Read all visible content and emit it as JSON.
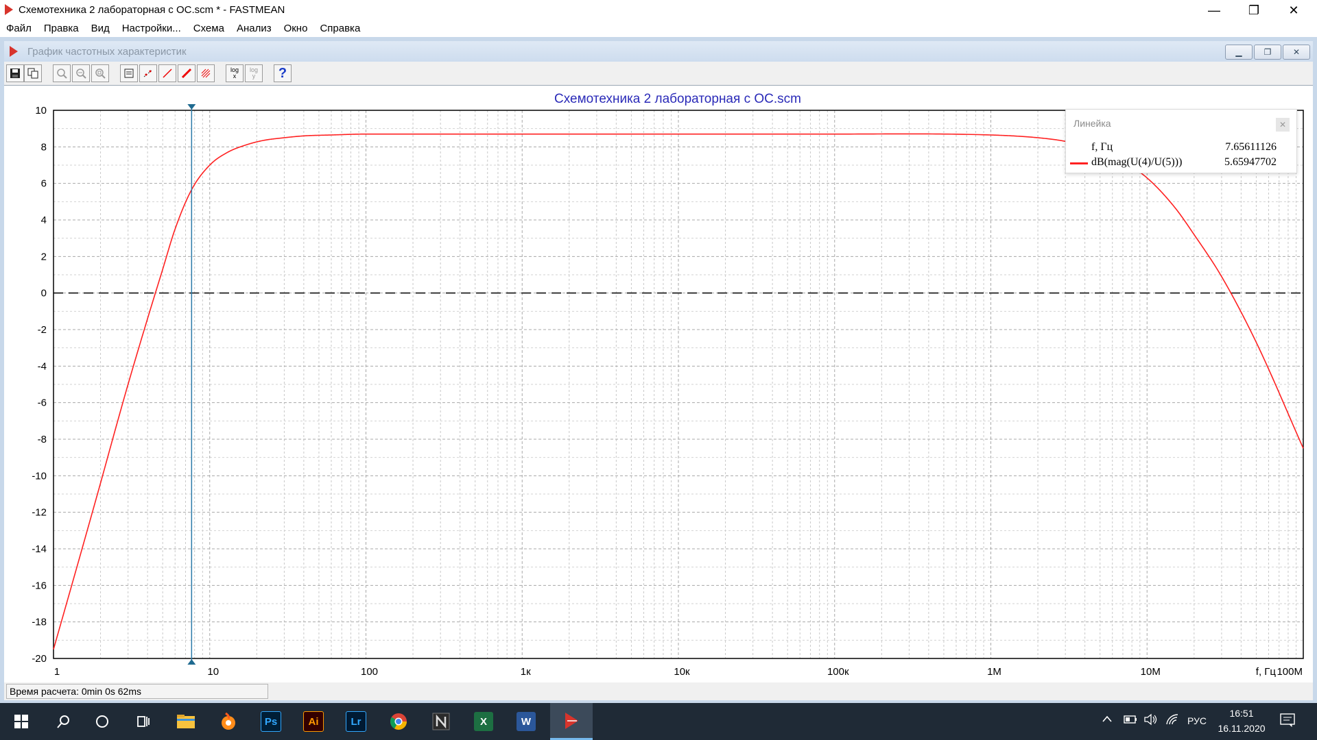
{
  "window": {
    "title": "Схемотехника 2 лабораторная с ОС.scm * - FASTMEAN",
    "minimize_label": "—",
    "restore_label": "❐",
    "close_label": "✕"
  },
  "menu": [
    "Файл",
    "Правка",
    "Вид",
    "Настройки...",
    "Схема",
    "Анализ",
    "Окно",
    "Справка"
  ],
  "child_window": {
    "title": "График частотных характеристик"
  },
  "toolbar": {
    "log_x_top": "log",
    "log_x_bottom": "x",
    "log_y_top": "log",
    "log_y_bottom": "y",
    "help_label": "?"
  },
  "chart_data": {
    "type": "line",
    "title": "Схемотехника 2 лабораторная с ОС.scm",
    "xscale": "log",
    "xlim": [
      1,
      100000000
    ],
    "ylim": [
      -20,
      10
    ],
    "yticks": [
      10,
      8,
      6,
      4,
      2,
      0,
      -2,
      -4,
      -6,
      -8,
      -10,
      -12,
      -14,
      -16,
      -18,
      -20
    ],
    "xticks": [
      {
        "value": 1,
        "label": "1"
      },
      {
        "value": 10,
        "label": "10"
      },
      {
        "value": 100,
        "label": "100"
      },
      {
        "value": 1000,
        "label": "1к"
      },
      {
        "value": 10000,
        "label": "10к"
      },
      {
        "value": 100000,
        "label": "100к"
      },
      {
        "value": 1000000,
        "label": "1М"
      },
      {
        "value": 10000000,
        "label": "10М"
      },
      {
        "value": 100000000,
        "label": "100М"
      }
    ],
    "xlabel": "f, Гц",
    "grid": true,
    "zero_line": true,
    "series": [
      {
        "name": "dB(mag(U(4)/U(5)))",
        "color": "#ff2020",
        "x": [
          1,
          1.5,
          2,
          2.5,
          3,
          4,
          5,
          6,
          7.66,
          10,
          13,
          17,
          22,
          30,
          40,
          60,
          100,
          1000,
          10000,
          100000,
          1000000,
          2000000,
          3000000,
          5000000,
          7000000,
          10000000,
          15000000,
          20000000,
          30000000,
          50000000,
          100000000
        ],
        "y": [
          -19.5,
          -14.2,
          -10.4,
          -7.4,
          -5.0,
          -1.4,
          1.3,
          3.5,
          5.66,
          7.0,
          7.7,
          8.1,
          8.35,
          8.5,
          8.6,
          8.65,
          8.7,
          8.7,
          8.7,
          8.7,
          8.65,
          8.5,
          8.3,
          7.8,
          7.2,
          6.3,
          4.7,
          3.2,
          0.9,
          -2.7,
          -8.5
        ]
      }
    ],
    "cursor": {
      "x": 7.65611126,
      "y": 5.65947702
    }
  },
  "ruler": {
    "title": "Линейка",
    "close_label": "✕",
    "f_label": "f, Гц",
    "f_value": "7.65611126",
    "series_label": "dB(mag(U(4)/U(5)))",
    "series_value": "5.65947702"
  },
  "status": {
    "text": "Время расчета: 0min 0s 62ms"
  },
  "taskbar": {
    "apps": [
      {
        "name": "photoshop",
        "label": "Ps",
        "bg": "#001e36",
        "fg": "#31a8ff"
      },
      {
        "name": "illustrator",
        "label": "Ai",
        "bg": "#330000",
        "fg": "#ff9a00"
      },
      {
        "name": "lightroom",
        "label": "Lr",
        "bg": "#001a33",
        "fg": "#31a8ff"
      },
      {
        "name": "excel",
        "label": "X",
        "bg": "#1d6f42",
        "fg": "#ffffff"
      },
      {
        "name": "word",
        "label": "W",
        "bg": "#2b579a",
        "fg": "#ffffff"
      }
    ],
    "lang": "РУС",
    "time": "16:51",
    "date": "16.11.2020"
  }
}
